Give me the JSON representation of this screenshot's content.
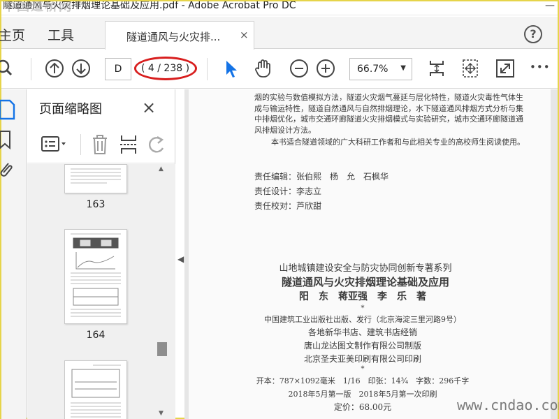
{
  "window": {
    "title": "隧道通风与火灾排烟理论基础及应用.pdf - Adobe Acrobat Pro DC",
    "controls": "—",
    "watermark_top": "中国道桥网",
    "watermark_bottom": "www.cndao.com"
  },
  "tabs": {
    "home": "主页",
    "tools": "工具",
    "doc_tab": "隧道通风与火灾排...",
    "close": "×",
    "help": "?"
  },
  "toolbar": {
    "page_input_value": "D",
    "page_count": "( 4 / 238 )",
    "zoom": "66.7%",
    "more": "•••"
  },
  "panel": {
    "title": "页面缩略图",
    "close": "×",
    "thumbnails": [
      {
        "label": "163"
      },
      {
        "label": "164"
      },
      {
        "label": ""
      }
    ]
  },
  "document": {
    "intro_lines": [
      "烟的实验与数值模拟方法，隧道火灾烟气蔓延与层化特性，隧道火灾毒性气体生",
      "成与输运特性，隧道自然通风与自然排烟理论，水下隧道通风排烟方式分析与集",
      "中排烟优化，城市交通环廊隧道火灾排烟模式与实验研究，城市交通环廊隧道通",
      "风排烟设计方法。"
    ],
    "audience": "本书适合隧道领域的广大科研工作者和与此相关专业的高校师生阅读使用。",
    "editor": "责任编辑：张伯熙　杨　允　石枫华",
    "designer": "责任设计：李志立",
    "proofreader": "责任校对：芦欣甜",
    "series": "山地城镇建设安全与防灾协同创新专著系列",
    "book_title": "隧道通风与火灾排烟理论基础及应用",
    "authors": "阳　东　蒋亚强　李　乐　著",
    "star": "*",
    "publisher": "中国建筑工业出版社出版、发行（北京海淀三里河路9号）",
    "sellers": "各地新华书店、建筑书店经销",
    "typesetter": "唐山龙达图文制作有限公司制版",
    "printer": "北京圣夫亚美印刷有限公司印刷",
    "specs": "开本：787×1092毫米　1/16　印张：14¾　字数：296千字",
    "edition": "2018年5月第一版　2018年5月第一次印刷",
    "price": "定价：68.00元"
  }
}
